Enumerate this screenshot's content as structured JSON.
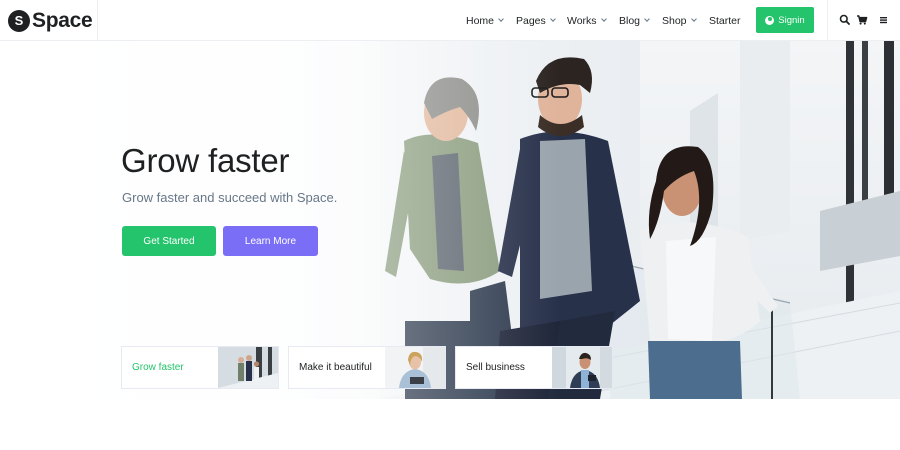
{
  "brand": {
    "badge": "S",
    "name": "Space"
  },
  "nav": {
    "items": [
      {
        "label": "Home",
        "dropdown": true
      },
      {
        "label": "Pages",
        "dropdown": true
      },
      {
        "label": "Works",
        "dropdown": true
      },
      {
        "label": "Blog",
        "dropdown": true
      },
      {
        "label": "Shop",
        "dropdown": true
      },
      {
        "label": "Starter",
        "dropdown": false
      }
    ],
    "signin_label": "Signin",
    "icons": [
      "user-icon",
      "search-icon",
      "cart-icon",
      "menu-icon"
    ]
  },
  "hero": {
    "title": "Grow faster",
    "subtitle": "Grow faster and succeed with Space.",
    "primary_button": "Get Started",
    "secondary_button": "Learn More"
  },
  "cards": [
    {
      "label": "Grow faster",
      "active": true
    },
    {
      "label": "Make it beautiful",
      "active": false
    },
    {
      "label": "Sell business",
      "active": false
    }
  ],
  "colors": {
    "accent_green": "#23c46b",
    "accent_purple": "#7b6ef6",
    "text_dark": "#1e2022",
    "text_muted": "#677788"
  }
}
